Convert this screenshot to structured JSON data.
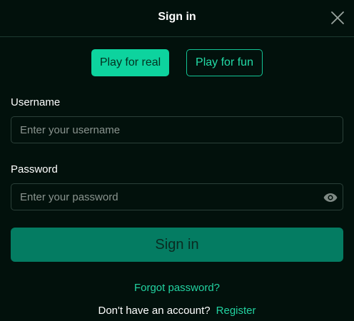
{
  "dialog": {
    "title": "Sign in"
  },
  "mode": {
    "real_label": "Play for real",
    "fun_label": "Play for fun",
    "selected": "Play for real"
  },
  "username": {
    "label": "Username",
    "placeholder": "Enter your username",
    "value": ""
  },
  "password": {
    "label": "Password",
    "placeholder": "Enter your password",
    "value": "",
    "toggle_icon": "eye-icon"
  },
  "actions": {
    "submit_label": "Sign in",
    "forgot_label": "Forgot password?",
    "no_account_text": "Don't have an account?",
    "register_label": "Register"
  },
  "icons": {
    "close": "close-icon",
    "visibility": "eye-icon"
  },
  "colors": {
    "background": "#02110c",
    "accent": "#0dd39e",
    "submit": "#047c62",
    "link": "#22d3a1",
    "border": "#2b4039"
  }
}
